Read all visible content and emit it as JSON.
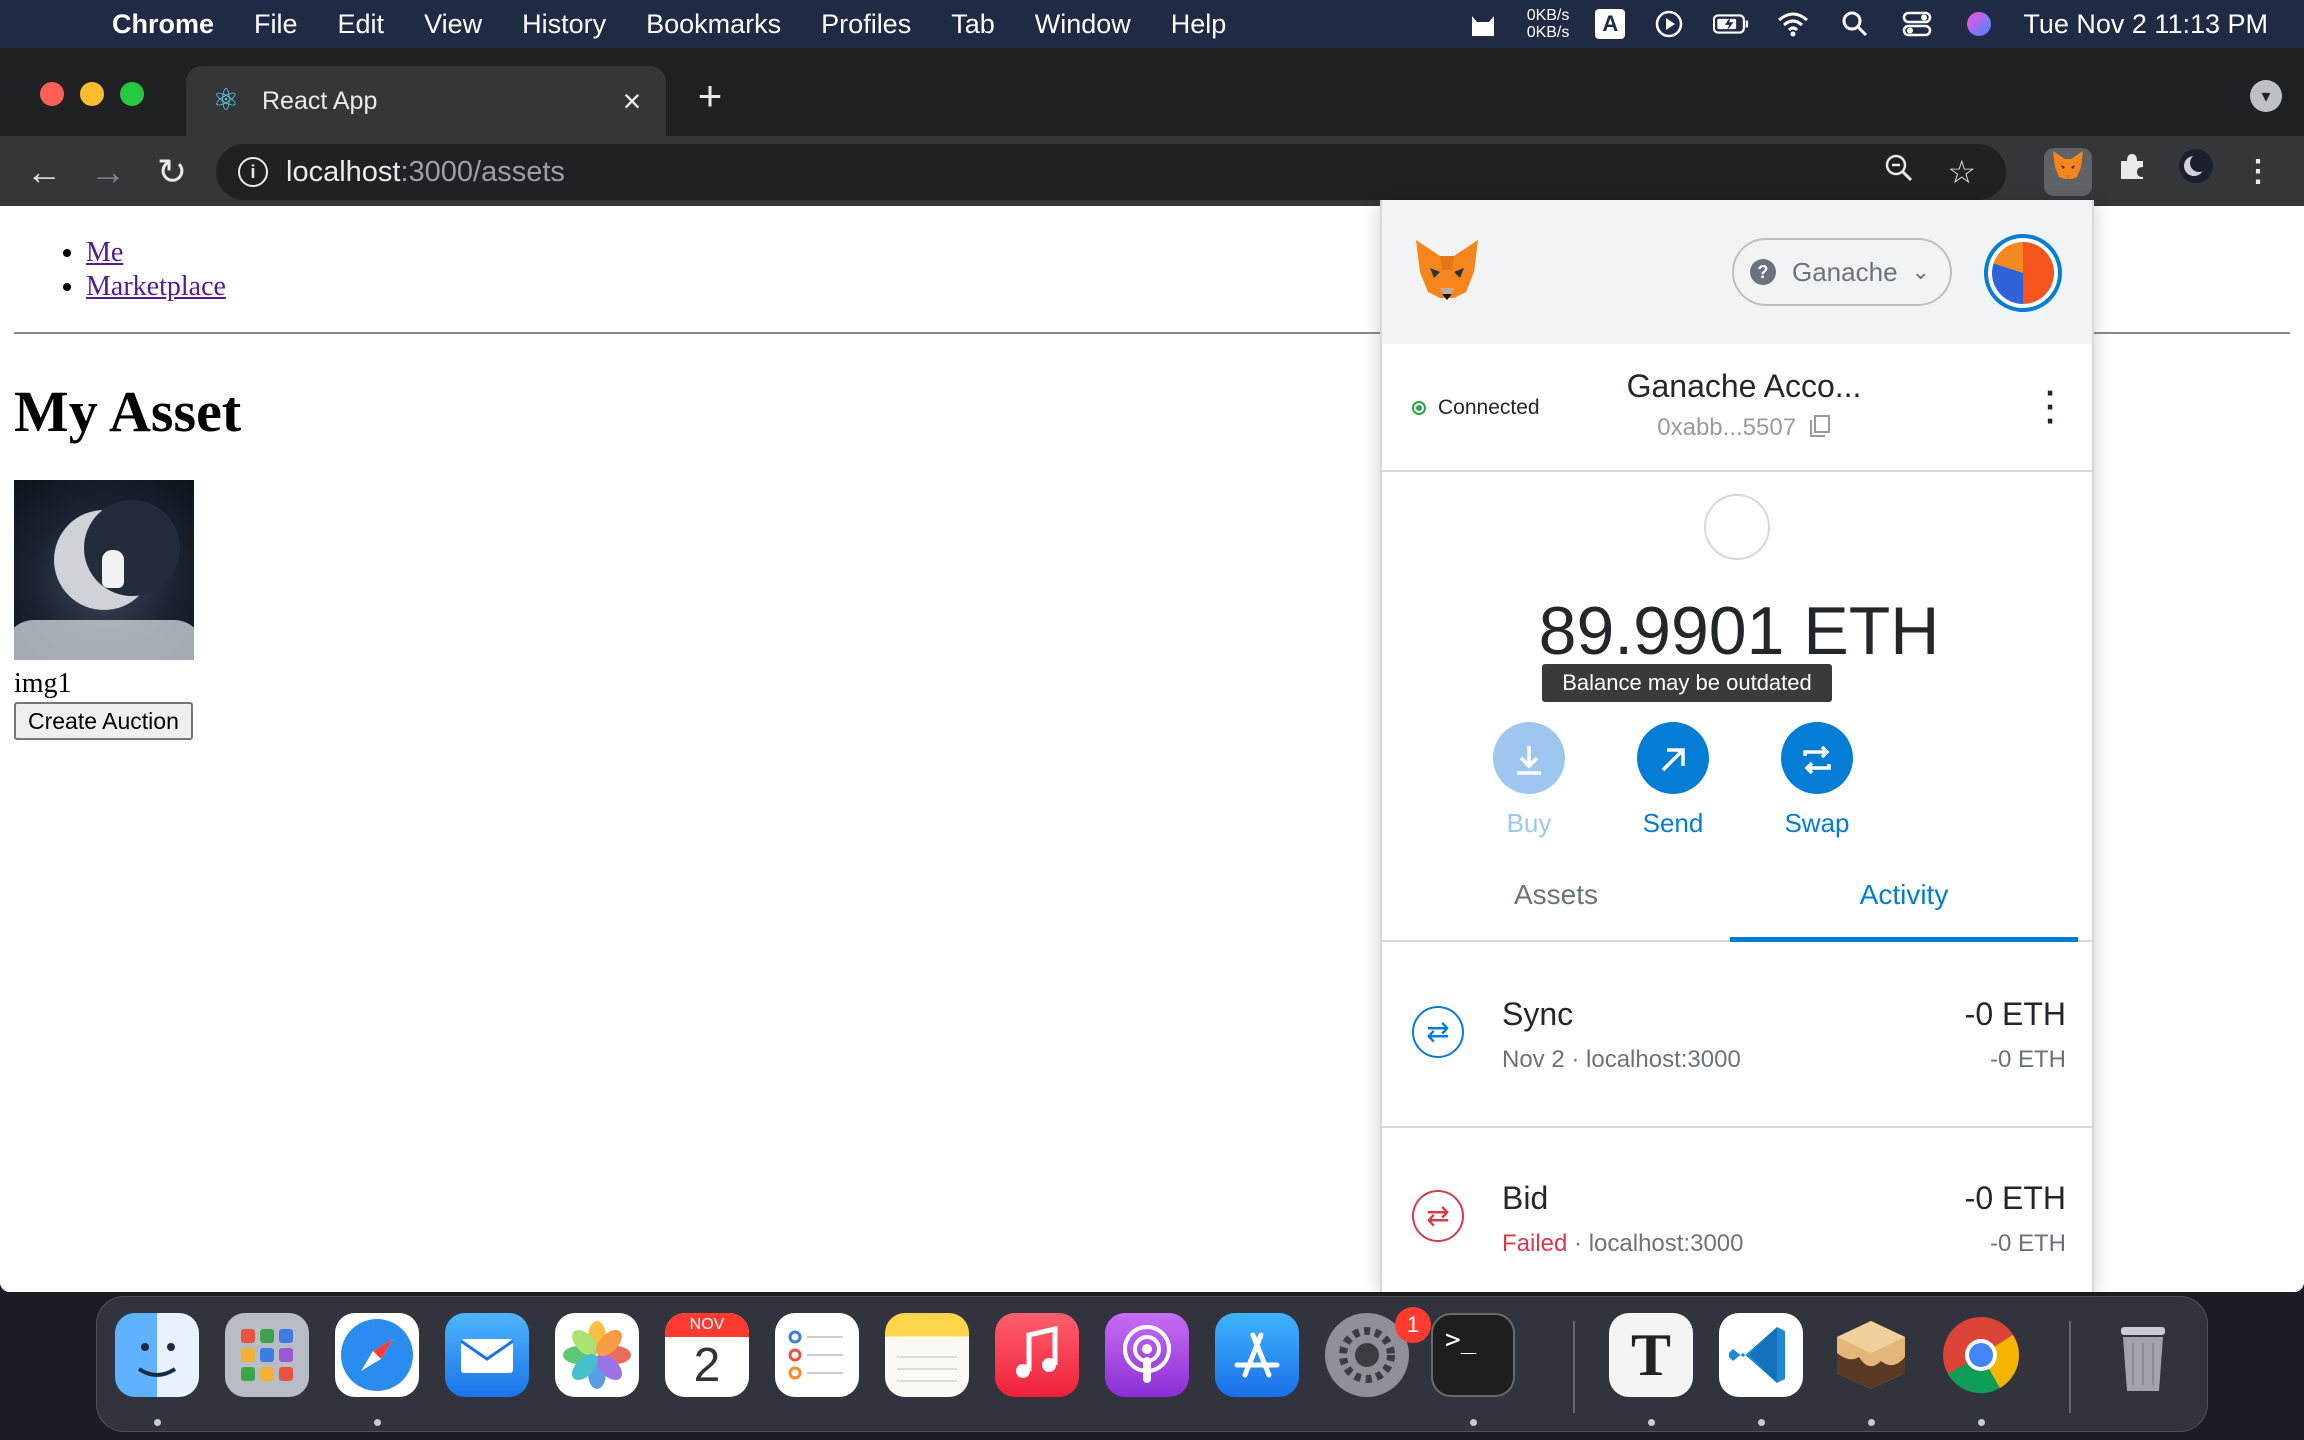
{
  "menubar": {
    "apple": "",
    "items": [
      "Chrome",
      "File",
      "Edit",
      "View",
      "History",
      "Bookmarks",
      "Profiles",
      "Tab",
      "Window",
      "Help"
    ],
    "net_up": "0KB/s",
    "net_down": "0KB/s",
    "input_source": "A",
    "datetime": "Tue Nov 2  11:13 PM"
  },
  "browser": {
    "tab_title": "React App",
    "url_host": "localhost",
    "url_path": ":3000/assets"
  },
  "page": {
    "nav": [
      "Me",
      "Marketplace"
    ],
    "heading": "My Asset",
    "asset_name": "img1",
    "create_auction_label": "Create Auction"
  },
  "metamask": {
    "network": "Ganache",
    "status": "Connected",
    "account_name": "Ganache Acco...",
    "account_address": "0xabb...5507",
    "balance": "89.9901 ETH",
    "tooltip": "Balance may be outdated",
    "actions": {
      "buy": "Buy",
      "send": "Send",
      "swap": "Swap"
    },
    "tabs": {
      "assets": "Assets",
      "activity": "Activity"
    },
    "transactions": [
      {
        "title": "Sync",
        "sub_date": "Nov 2",
        "sub_origin": "localhost:3000",
        "amount": "-0 ETH",
        "amount2": "-0 ETH"
      },
      {
        "title": "Bid",
        "sub_status": "Failed",
        "sub_origin": "localhost:3000",
        "amount": "-0 ETH",
        "amount2": "-0 ETH"
      }
    ]
  },
  "dock": {
    "calendar_month": "NOV",
    "calendar_day": "2",
    "settings_badge": "1",
    "textedit_glyph": "T",
    "terminal_glyph": ">_"
  },
  "colors": {
    "metamask_blue": "#037dd6",
    "failed_red": "#d73a49",
    "chrome_dark": "#202124"
  }
}
